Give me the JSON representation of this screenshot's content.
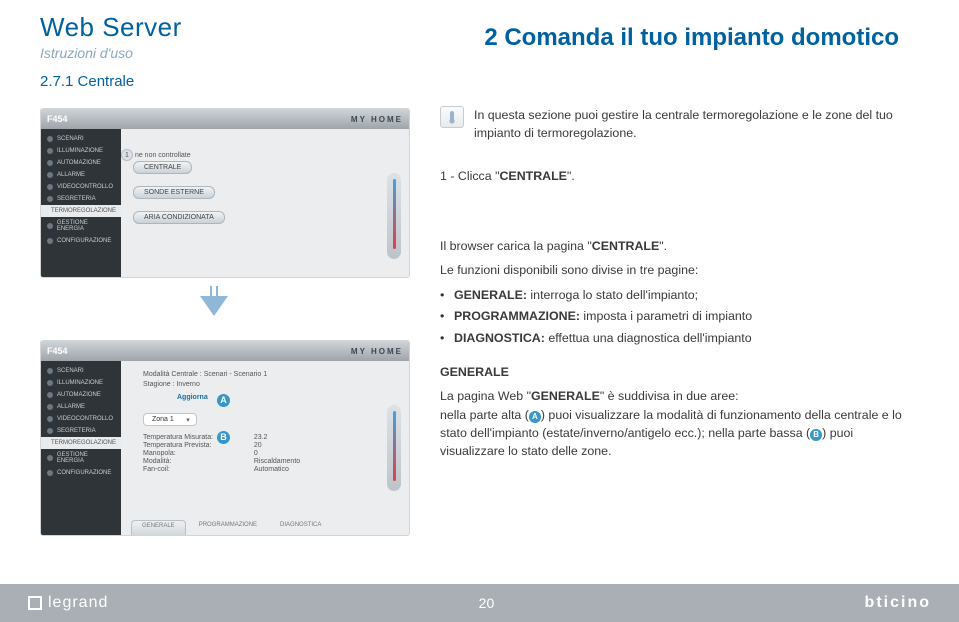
{
  "header": {
    "title": "Web Server",
    "subtitle": "Istruzioni d'uso",
    "section": "2.7.1 Centrale"
  },
  "chapter": "2 Comanda il tuo impianto domotico",
  "app": {
    "model": "F454",
    "brand": "MY HOME",
    "sidebar": [
      "SCENARI",
      "ILLUMINAZIONE",
      "AUTOMAZIONE",
      "ALLARME",
      "VIDEOCONTROLLO",
      "SEGRETERIA",
      "TERMOREGOLAZIONE",
      "GESTIONE ENERGIA",
      "CONFIGURAZIONE"
    ],
    "active_index": 6,
    "panel1": {
      "hint": "ne non controllate",
      "rows": [
        "CENTRALE",
        "SONDE ESTERNE",
        "ARIA CONDIZIONATA"
      ]
    },
    "panel2": {
      "mode_label": "Modalità Centrale :",
      "mode_value": "Scenari - Scenario 1",
      "season_label": "Stagione :",
      "season_value": "Inverno",
      "refresh": "Aggiorna",
      "zone": "Zona 1",
      "grid": [
        [
          "Temperatura Misurata:",
          "23.2"
        ],
        [
          "Temperatura Prevista:",
          "20"
        ],
        [
          "Manopola:",
          "0"
        ],
        [
          "Modalità:",
          "Riscaldamento"
        ],
        [
          "Fan-coil:",
          "Automatico"
        ]
      ],
      "tabs": [
        "GENERALE",
        "PROGRAMMAZIONE",
        "DIAGNOSTICA"
      ]
    }
  },
  "right": {
    "intro": "In questa sezione puoi gestire la centrale termoregolazione e le zone del tuo impianto di termoregolazione.",
    "step_prefix": "1 -  Clicca \"",
    "step_bold": "CENTRALE",
    "step_suffix": "\".",
    "p2a": "Il browser carica la pagina \"",
    "p2a_bold": "CENTRALE",
    "p2a_end": "\".",
    "p2b": "Le funzioni disponibili sono divise in tre pagine:",
    "bullets": [
      {
        "b": "GENERALE:",
        "t": " interroga lo stato dell'impianto;"
      },
      {
        "b": "PROGRAMMAZIONE:",
        "t": " imposta i parametri di impianto"
      },
      {
        "b": "DIAGNOSTICA:",
        "t": " effettua una diagnostica dell'impianto"
      }
    ],
    "g_title": "GENERALE",
    "g_text_a": "La pagina Web \"",
    "g_text_a_bold": "GENERALE",
    "g_text_a_mid": "\" è suddivisa in due aree:",
    "g_text_b1": "nella parte alta (",
    "g_text_b2": ") puoi visualizzare la modalità di funzionamento della centrale e lo stato dell'impianto (estate/inverno/antigelo ecc.); nella parte bassa (",
    "g_text_b3": ") puoi visualizzare lo stato delle zone.",
    "markerA": "A",
    "markerB": "B"
  },
  "footer": {
    "left": "legrand",
    "page": "20",
    "right": "bticino"
  }
}
